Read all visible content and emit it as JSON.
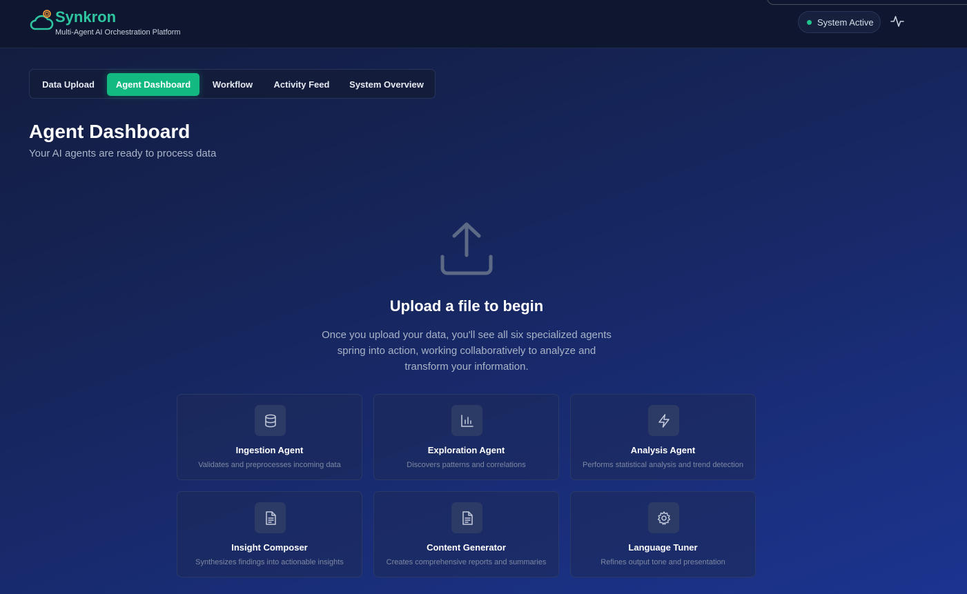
{
  "header": {
    "brand_name": "Synkron",
    "tagline": "Multi-Agent AI Orchestration Platform",
    "status_text": "System Active",
    "logo_icon": "cloud-cog-icon",
    "activity_icon": "activity-pulse-icon"
  },
  "tabs": [
    {
      "label": "Data Upload",
      "active": false
    },
    {
      "label": "Agent Dashboard",
      "active": true
    },
    {
      "label": "Workflow",
      "active": false
    },
    {
      "label": "Activity Feed",
      "active": false
    },
    {
      "label": "System Overview",
      "active": false
    }
  ],
  "page": {
    "title": "Agent Dashboard",
    "subtitle": "Your AI agents are ready to process data"
  },
  "upload": {
    "icon": "upload-icon",
    "heading": "Upload a file to begin",
    "description": "Once you upload your data, you'll see all six specialized agents spring into action, working collaboratively to analyze and transform your information."
  },
  "agents": [
    {
      "name": "Ingestion Agent",
      "description": "Validates and preprocesses incoming data",
      "icon": "database-icon"
    },
    {
      "name": "Exploration Agent",
      "description": "Discovers patterns and correlations",
      "icon": "bar-chart-icon"
    },
    {
      "name": "Analysis Agent",
      "description": "Performs statistical analysis and trend detection",
      "icon": "lightning-icon"
    },
    {
      "name": "Insight Composer",
      "description": "Synthesizes findings into actionable insights",
      "icon": "document-icon"
    },
    {
      "name": "Content Generator",
      "description": "Creates comprehensive reports and summaries",
      "icon": "document-icon"
    },
    {
      "name": "Language Tuner",
      "description": "Refines output tone and presentation",
      "icon": "gear-icon"
    }
  ],
  "colors": {
    "accent": "#12b981",
    "brand": "#2ec5a0",
    "status_dot": "#21c38c"
  }
}
